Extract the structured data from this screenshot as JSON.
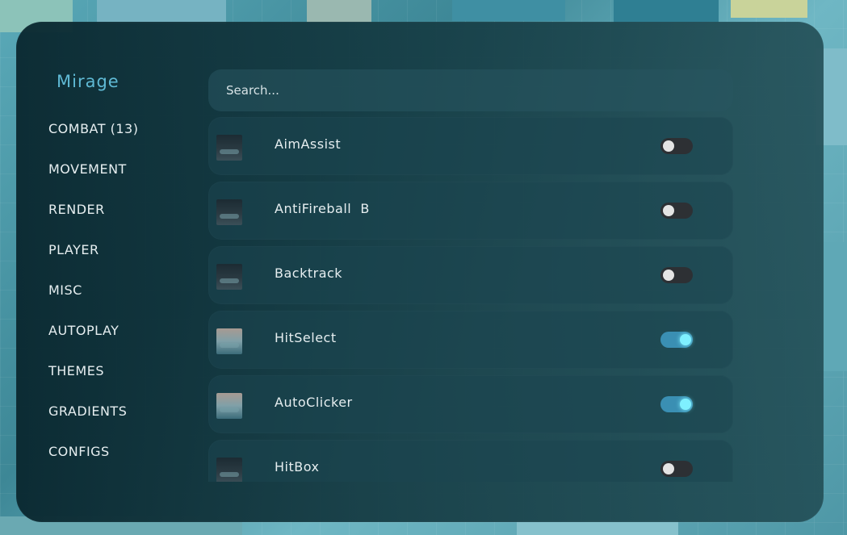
{
  "sidebar": {
    "brand": "Mirage",
    "items": [
      {
        "label": "COMBAT (13)"
      },
      {
        "label": "MOVEMENT"
      },
      {
        "label": "RENDER"
      },
      {
        "label": "PLAYER"
      },
      {
        "label": "MISC"
      },
      {
        "label": "AUTOPLAY"
      },
      {
        "label": "THEMES"
      },
      {
        "label": "GRADIENTS"
      },
      {
        "label": "CONFIGS"
      }
    ]
  },
  "search": {
    "placeholder": "Search...",
    "value": ""
  },
  "modules": [
    {
      "name": "AimAssist",
      "enabled": false,
      "icon": "module-thumbnail"
    },
    {
      "name": "AntiFireball  B",
      "enabled": false,
      "icon": "module-thumbnail"
    },
    {
      "name": "Backtrack",
      "enabled": false,
      "icon": "module-thumbnail"
    },
    {
      "name": "HitSelect",
      "enabled": true,
      "icon": "module-thumbnail"
    },
    {
      "name": "AutoClicker",
      "enabled": true,
      "icon": "module-thumbnail"
    },
    {
      "name": "HitBox",
      "enabled": false,
      "icon": "module-thumbnail"
    }
  ],
  "colors": {
    "accent": "#5fb9d4",
    "toggle_on": "#3a8fb3",
    "toggle_knob_on": "#7ff0ff",
    "toggle_off": "#2d3034"
  }
}
